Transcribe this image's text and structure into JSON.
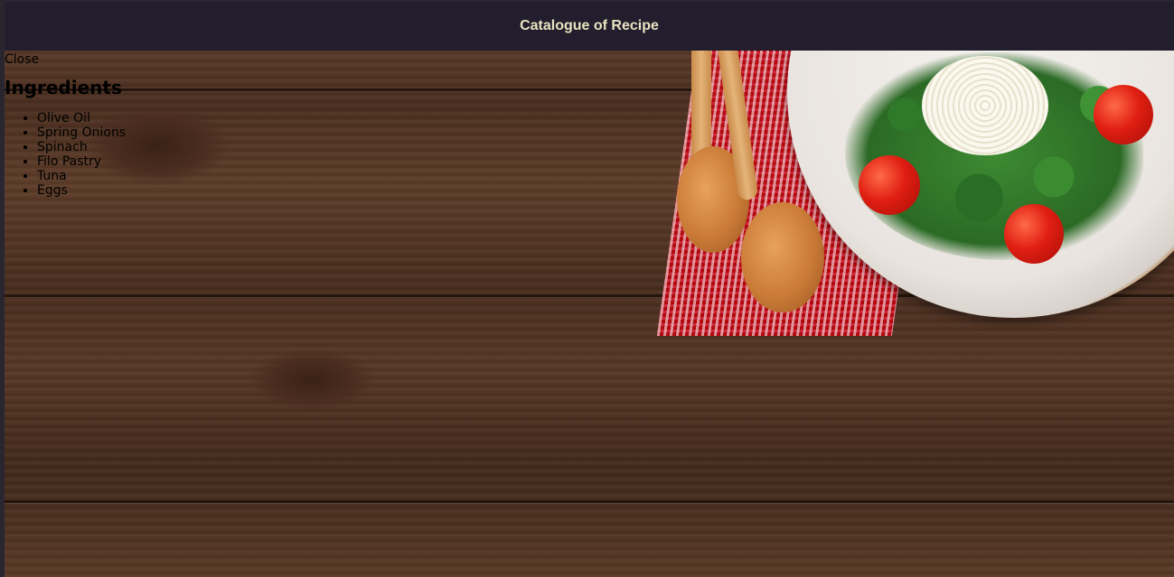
{
  "header": {
    "title": "Catalogue of Recipe"
  },
  "panel": {
    "close_label": "Close",
    "heading": "Ingredients",
    "ingredients": [
      "Olive Oil",
      "Spring Onions",
      "Spinach",
      "Filo Pastry",
      "Tuna",
      "Eggs"
    ]
  },
  "colors": {
    "header_bg": "#221e2e",
    "header_text": "#e9e3bf",
    "wood": "#4b2f20"
  },
  "background": {
    "image": "wooden-table-with-salad-plate-photo"
  }
}
